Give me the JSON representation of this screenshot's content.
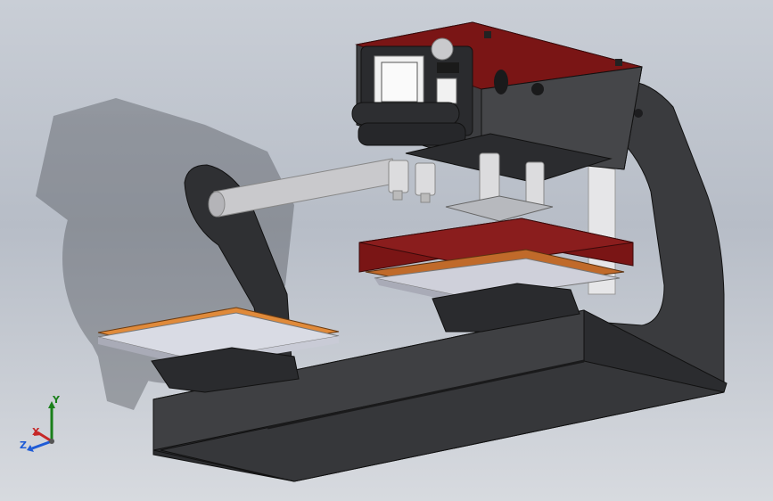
{
  "view": {
    "background_top": "#c9ced6",
    "background_bottom": "#d7dadf"
  },
  "model": {
    "frame_color": "#3a3b3e",
    "heat_platen_color": "#7a1515",
    "lower_platen_color": "#b9bbc8",
    "pad_color": "#d9792b",
    "rod_color": "#c9c9cc"
  },
  "triad": {
    "x_label": "X",
    "y_label": "Y",
    "z_label": "Z",
    "x_color": "#c62828",
    "y_color": "#1a7f1a",
    "z_color": "#1e5bd6"
  }
}
